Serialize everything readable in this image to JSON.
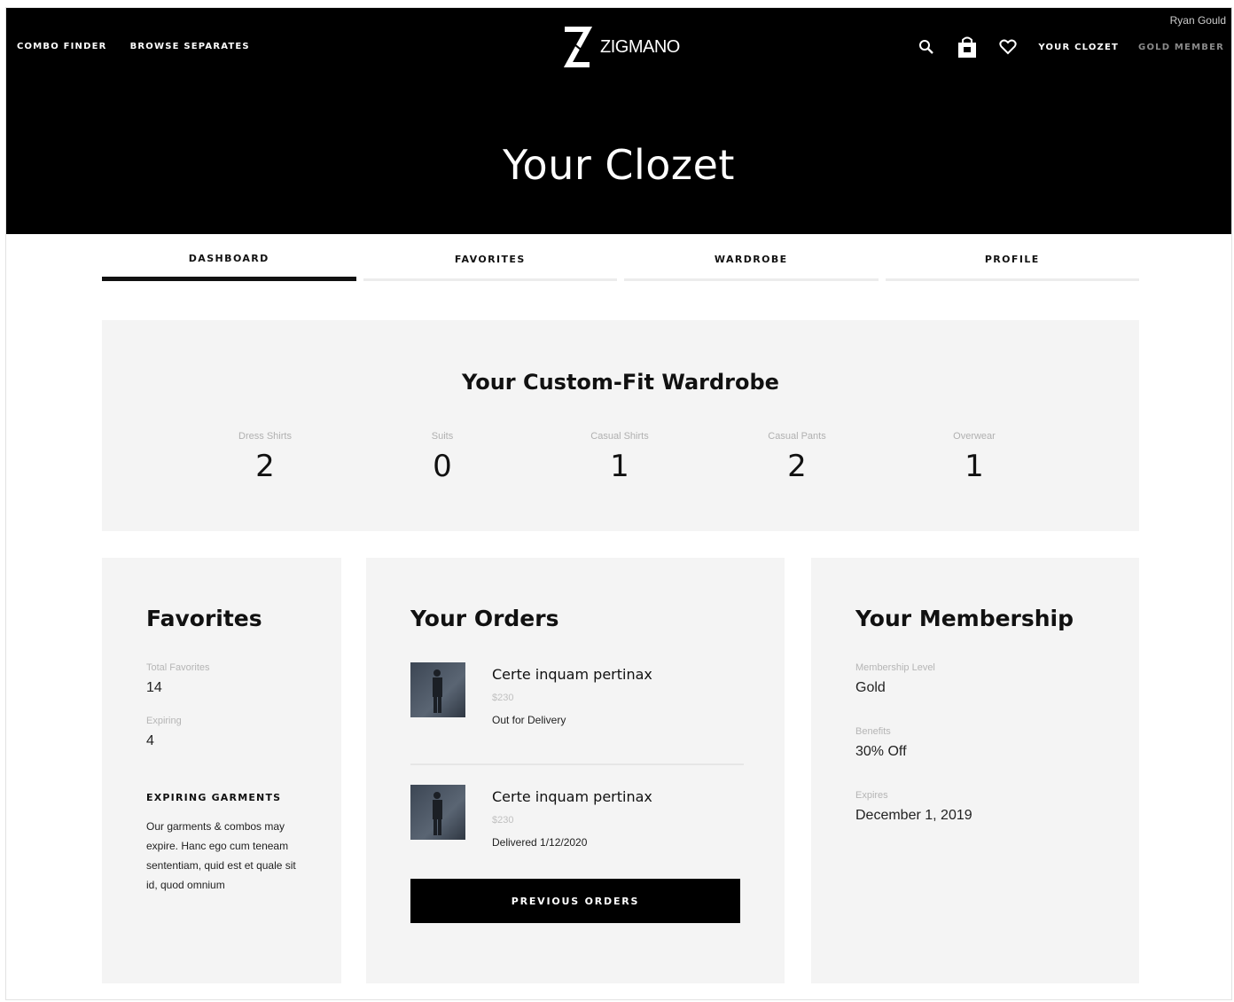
{
  "header": {
    "nav_left": [
      "COMBO FINDER",
      "BROWSE SEPARATES"
    ],
    "brand": {
      "name": "ZIGMANO"
    },
    "user_name": "Ryan Gould",
    "nav_right": {
      "your_clozet": "YOUR CLOZET",
      "membership": "GOLD MEMBER"
    },
    "icons": [
      "search-icon",
      "shopping-bag-icon",
      "heart-icon"
    ],
    "title": "Your Clozet"
  },
  "tabs": [
    {
      "label": "DASHBOARD",
      "active": true
    },
    {
      "label": "FAVORITES",
      "active": false
    },
    {
      "label": "WARDROBE",
      "active": false
    },
    {
      "label": "PROFILE",
      "active": false
    }
  ],
  "wardrobe": {
    "title": "Your Custom-Fit Wardrobe",
    "stats": [
      {
        "label": "Dress Shirts",
        "value": "2"
      },
      {
        "label": "Suits",
        "value": "0"
      },
      {
        "label": "Casual Shirts",
        "value": "1"
      },
      {
        "label": "Casual Pants",
        "value": "2"
      },
      {
        "label": "Overwear",
        "value": "1"
      }
    ]
  },
  "favorites": {
    "title": "Favorites",
    "total_label": "Total Favorites",
    "total_value": "14",
    "expiring_label": "Expiring",
    "expiring_value": "4",
    "expiring_heading": "EXPIRING GARMENTS",
    "expiring_text": "Our garments & combos may expire. Hanc ego cum teneam sententiam, quid est et quale sit id, quod omnium"
  },
  "orders": {
    "title": "Your Orders",
    "items": [
      {
        "name": "Certe inquam pertinax",
        "price": "$230",
        "status": "Out for Delivery"
      },
      {
        "name": "Certe inquam pertinax",
        "price": "$230",
        "status": "Delivered 1/12/2020"
      }
    ],
    "button_label": "PREVIOUS ORDERS"
  },
  "membership": {
    "title": "Your Membership",
    "level_label": "Membership Level",
    "level_value": "Gold",
    "benefits_label": "Benefits",
    "benefits_value": "30% Off",
    "expires_label": "Expires",
    "expires_value": "December 1, 2019"
  },
  "colors": {
    "header_bg": "#000000",
    "card_bg": "#f4f4f4",
    "accent": "#111111"
  }
}
